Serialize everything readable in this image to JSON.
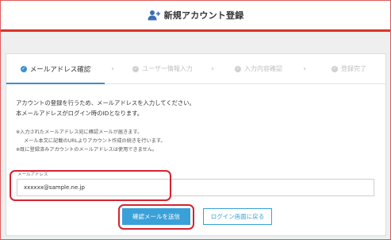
{
  "header": {
    "title": "新規アカウント登録",
    "icon": "user-add-icon",
    "accent_color": "#d9342b"
  },
  "steps": [
    {
      "label": "メールアドレス確認",
      "state": "active"
    },
    {
      "label": "ユーザー情報入力",
      "state": "inactive"
    },
    {
      "label": "入力内容確認",
      "state": "inactive"
    },
    {
      "label": "登録完了",
      "state": "inactive"
    }
  ],
  "intro": {
    "line1": "アカウントの登録を行うため、メールアドレスを入力してください。",
    "line2": "本メールアドレスがログイン時のIDとなります。"
  },
  "notes": {
    "line1": "※入力されたメールアドレス宛に確認メールが届きます。",
    "line2": "メール本文に記載のURLよりアカウント作成の続きを行います。",
    "line3": "※既に登録済みアカウントのメールアドレスは使用できません。"
  },
  "form": {
    "email_label": "メールアドレス",
    "email_value": "xxxxxx@sample.ne.jp"
  },
  "buttons": {
    "send": "確認メールを送信",
    "back": "ログイン画面に戻る"
  },
  "colors": {
    "primary": "#3aa0d8",
    "highlight": "#d6232f"
  }
}
